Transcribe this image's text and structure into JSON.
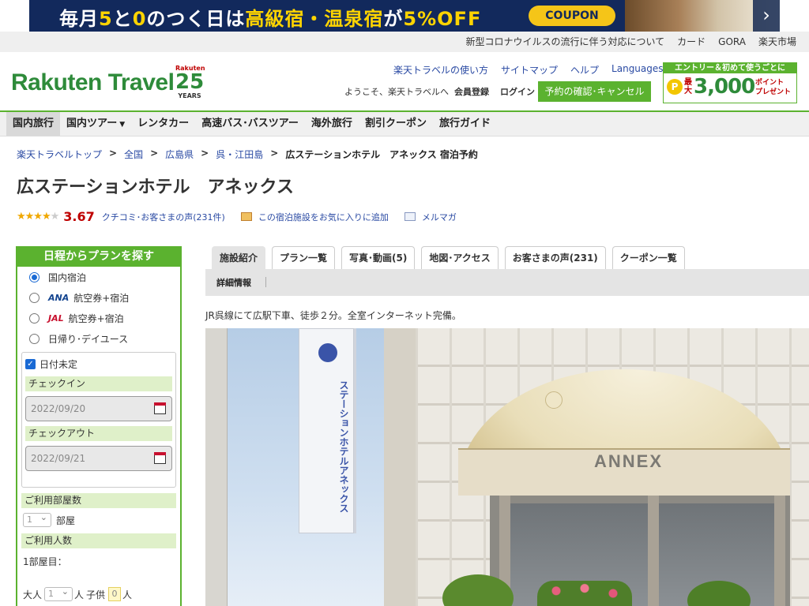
{
  "banner": {
    "text_pre": "毎月",
    "five": "5",
    "to": "と",
    "zero": "0",
    "text_mid": "のつく日は",
    "highlight": "高級宿・温泉宿",
    "ga": "が",
    "discount": "5%OFF",
    "coupon": "COUPON"
  },
  "util_links": [
    "新型コロナウイルスの流行に伴う対応について",
    "カード",
    "GORA",
    "楽天市場"
  ],
  "header": {
    "logo": "Rakuten Travel",
    "anniv_brand": "Rakuten",
    "anniv_number": "25",
    "anniv_years": "YEARS",
    "links": [
      "楽天トラベルの使い方",
      "サイトマップ",
      "ヘルプ",
      "Languages"
    ],
    "welcome": "ようこそ、楽天トラベルへ",
    "register": "会員登録",
    "login": "ログイン",
    "confirm_button": "予約の確認･キャンセル",
    "promo_head": "エントリー＆初めて使うごとに",
    "promo_coin": "P",
    "promo_max": "最大",
    "promo_amount": "3,000",
    "promo_points": "ポイント",
    "promo_present": "プレゼント"
  },
  "nav": {
    "items": [
      "国内旅行",
      "国内ツアー",
      "レンタカー",
      "高速バス･バスツアー",
      "海外旅行",
      "割引クーポン",
      "旅行ガイド"
    ]
  },
  "breadcrumb": {
    "items": [
      "楽天トラベルトップ",
      "全国",
      "広島県",
      "呉・江田島"
    ],
    "current": "広ステーションホテル　アネックス 宿泊予約",
    "separator": ">"
  },
  "hotel": {
    "title": "広ステーションホテル　アネックス",
    "rating": "3.67",
    "rating_value": 3.67,
    "rating_max": 5,
    "reviews_link": "クチコミ･お客さまの声(231件)",
    "favorite_link": "この宿泊施設をお気に入りに追加",
    "mail_link": "メルマガ",
    "description": "JR呉線にて広駅下車、徒歩２分。全室インターネット完備。"
  },
  "search": {
    "title": "日程からプランを探す",
    "options": [
      {
        "label": "国内宿泊",
        "selected": true
      },
      {
        "airline": "ANA",
        "label": "航空券+宿泊",
        "selected": false
      },
      {
        "airline": "JAL",
        "label": "航空券+宿泊",
        "selected": false
      },
      {
        "label": "日帰り･デイユース",
        "selected": false
      }
    ],
    "undecided_label": "日付未定",
    "undecided_checked": true,
    "checkin_label": "チェックイン",
    "checkin_placeholder": "2022/09/20",
    "checkout_label": "チェックアウト",
    "checkout_placeholder": "2022/09/21",
    "rooms_label": "ご利用部屋数",
    "rooms_value": "1",
    "rooms_unit": "部屋",
    "guests_label": "ご利用人数",
    "room1_label": "1部屋目：",
    "adult_label": "大人",
    "adult_value": "1",
    "person_unit": "人",
    "child_label": "子供",
    "child_value": "0"
  },
  "tabs": {
    "items": [
      "施設紹介",
      "プラン一覧",
      "写真･動画(5)",
      "地図･アクセス",
      "お客さまの声(231)",
      "クーポン一覧"
    ],
    "active_index": 0,
    "sub_item": "詳細情報"
  },
  "photo": {
    "sign_text": "ステーションホテルアネックス",
    "awning_text": "ANNEX"
  },
  "colors": {
    "brand_green": "#5bb22f",
    "link_blue": "#2a4aa3",
    "rating_red": "#bf0000",
    "banner_navy": "#12295c"
  }
}
